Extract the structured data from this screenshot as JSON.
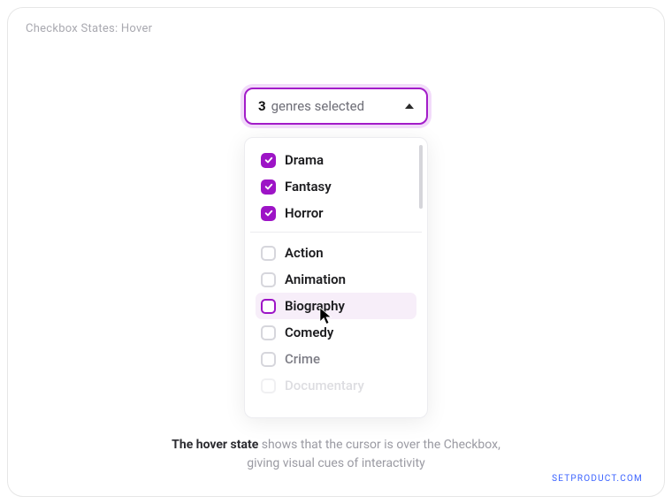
{
  "title": "Checkbox States: Hover",
  "select": {
    "count": "3",
    "label": "genres selected"
  },
  "groups": {
    "selected": [
      {
        "label": "Drama"
      },
      {
        "label": "Fantasy"
      },
      {
        "label": "Horror"
      }
    ],
    "unselected": [
      {
        "label": "Action",
        "state": "default"
      },
      {
        "label": "Animation",
        "state": "default"
      },
      {
        "label": "Biography",
        "state": "hover"
      },
      {
        "label": "Comedy",
        "state": "default"
      },
      {
        "label": "Crime",
        "state": "dim"
      },
      {
        "label": "Documentary",
        "state": "faded"
      }
    ]
  },
  "caption": {
    "bold": "The hover state",
    "rest1": " shows that the cursor is over the Checkbox,",
    "rest2": "giving visual cues of interactivity"
  },
  "watermark": "SETPRODUCT.COM"
}
